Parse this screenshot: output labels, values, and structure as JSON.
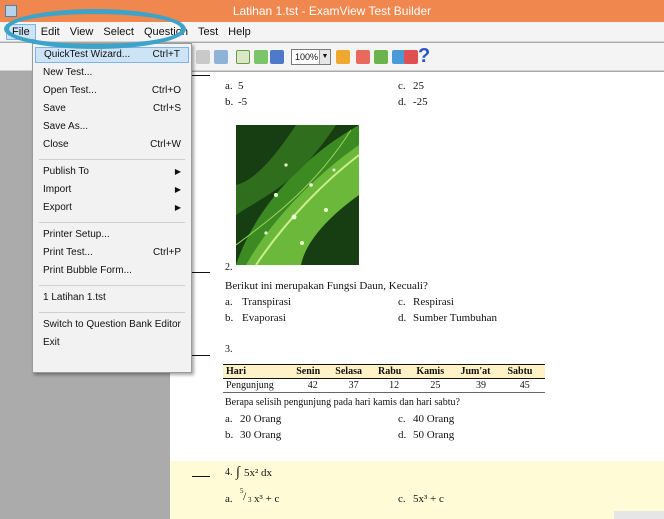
{
  "window": {
    "title": "Latihan 1.tst - ExamView Test Builder"
  },
  "menubar": [
    "File",
    "Edit",
    "View",
    "Select",
    "Question",
    "Test",
    "Help"
  ],
  "toolbar": {
    "zoom": "100%",
    "help": "?"
  },
  "file_menu": {
    "items": [
      {
        "label": "QuickTest Wizard...",
        "shortcut": "Ctrl+T"
      },
      {
        "label": "New Test...",
        "shortcut": ""
      },
      {
        "label": "Open Test...",
        "shortcut": "Ctrl+O"
      },
      {
        "label": "Save",
        "shortcut": "Ctrl+S"
      },
      {
        "label": "Save As...",
        "shortcut": ""
      },
      {
        "label": "Close",
        "shortcut": "Ctrl+W"
      },
      {
        "label": "Publish To",
        "shortcut": ""
      },
      {
        "label": "Import",
        "shortcut": ""
      },
      {
        "label": "Export",
        "shortcut": ""
      },
      {
        "label": "Printer Setup...",
        "shortcut": ""
      },
      {
        "label": "Print Test...",
        "shortcut": "Ctrl+P"
      },
      {
        "label": "Print Bubble Form...",
        "shortcut": ""
      },
      {
        "label": "1 Latihan 1.tst",
        "shortcut": ""
      },
      {
        "label": "Switch to Question Bank Editor",
        "shortcut": ""
      },
      {
        "label": "Exit",
        "shortcut": ""
      }
    ]
  },
  "document": {
    "q1": {
      "options": [
        {
          "letter": "a.",
          "text": "5"
        },
        {
          "letter": "b.",
          "text": "-5"
        },
        {
          "letter": "c.",
          "text": "25"
        },
        {
          "letter": "d.",
          "text": "-25"
        }
      ]
    },
    "q2": {
      "number": "2.",
      "question": "Berikut ini merupakan Fungsi Daun, Kecuali?",
      "options": [
        {
          "letter": "a.",
          "text": "Transpirasi"
        },
        {
          "letter": "b.",
          "text": "Evaporasi"
        },
        {
          "letter": "c.",
          "text": "Respirasi"
        },
        {
          "letter": "d.",
          "text": "Sumber Tumbuhan"
        }
      ]
    },
    "q3": {
      "number": "3.",
      "table": {
        "headers": [
          "Hari",
          "Senin",
          "Selasa",
          "Rabu",
          "Kamis",
          "Jum'at",
          "Sabtu"
        ],
        "row": [
          "Pengunjung",
          "42",
          "37",
          "12",
          "25",
          "39",
          "45"
        ]
      },
      "question": "Berapa selisih pengunjung pada hari kamis dan hari sabtu?",
      "options": [
        {
          "letter": "a.",
          "text": "20 Orang"
        },
        {
          "letter": "b.",
          "text": "30 Orang"
        },
        {
          "letter": "c.",
          "text": "40 Orang"
        },
        {
          "letter": "d.",
          "text": "50 Orang"
        }
      ]
    },
    "q4": {
      "number": "4.",
      "integral": "5x² dx",
      "option_a_letter": "a.",
      "option_a": "x³ + c",
      "option_a_coef_num": "5",
      "option_a_coef_den": "3",
      "option_c_letter": "c.",
      "option_c": "5x³ + c"
    }
  },
  "colors": {
    "titlebar": "#f0874f",
    "callout": "#3ea3c9",
    "table_header": "#fff2c6",
    "selected_question": "#fffbd6"
  }
}
